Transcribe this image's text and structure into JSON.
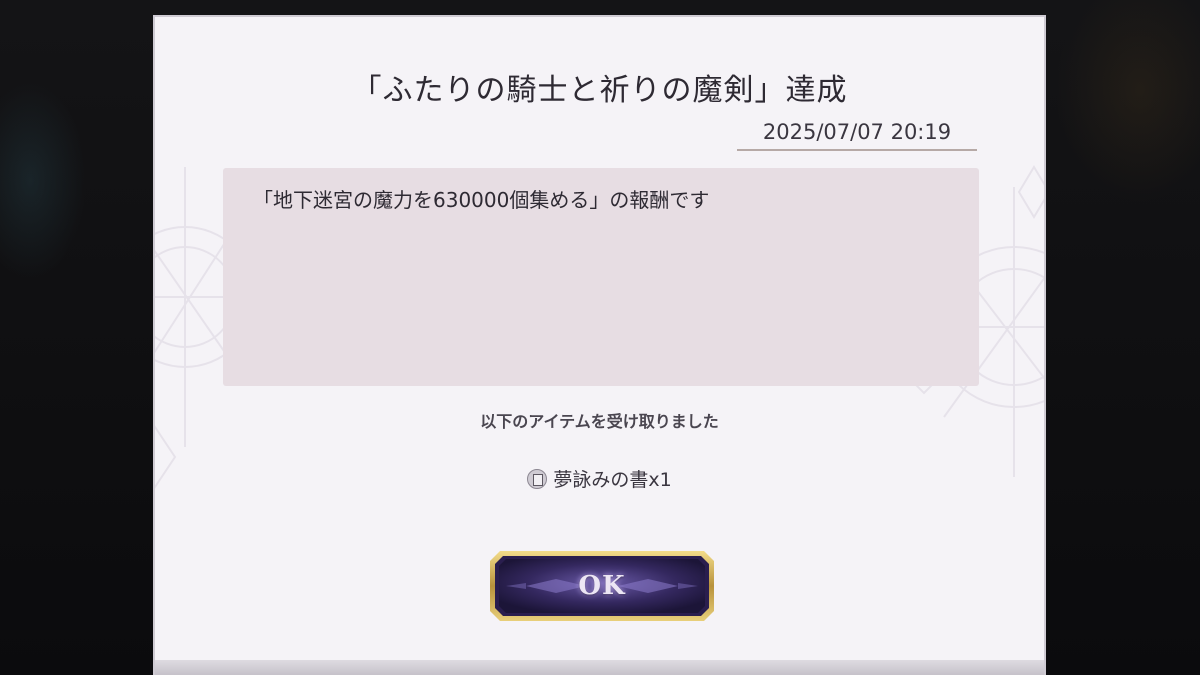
{
  "dialog": {
    "title": "「ふたりの騎士と祈りの魔剣」達成",
    "timestamp": "2025/07/07 20:19",
    "message": "「地下迷宮の魔力を630000個集める」の報酬です",
    "received_text": "以下のアイテムを受け取りました",
    "reward_item": {
      "icon": "book-item-icon",
      "label": "夢詠みの書x1"
    },
    "ok_button_label": "OK"
  },
  "colors": {
    "dialog_bg": "#f5f3f7",
    "message_bg": "#e7dde3",
    "button_face": "#2a1e4e",
    "button_frame": "#c9a74a"
  }
}
